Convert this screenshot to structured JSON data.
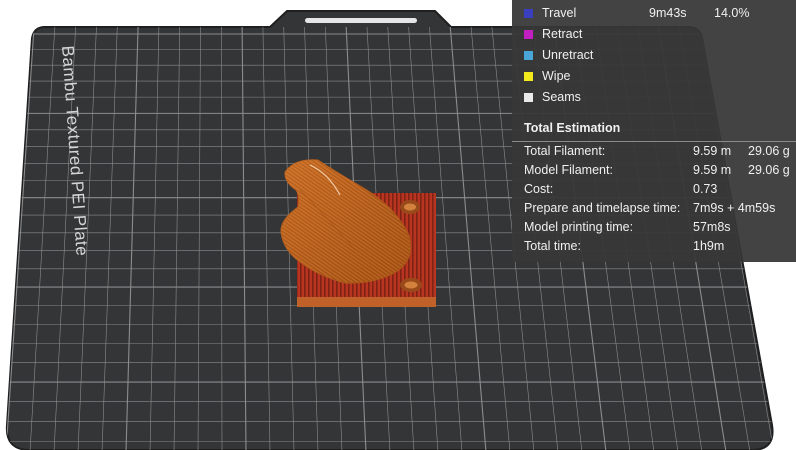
{
  "plate": {
    "label": "Bambu Textured PEI Plate"
  },
  "legend": {
    "items": [
      {
        "label": "Travel",
        "color": "#3a3fbf",
        "time": "9m43s",
        "percent": "14.0%"
      },
      {
        "label": "Retract",
        "color": "#c21fc2",
        "time": "",
        "percent": ""
      },
      {
        "label": "Unretract",
        "color": "#4aa6d6",
        "time": "",
        "percent": ""
      },
      {
        "label": "Wipe",
        "color": "#f2ea1a",
        "time": "",
        "percent": ""
      },
      {
        "label": "Seams",
        "color": "#eaeaea",
        "time": "",
        "percent": ""
      }
    ]
  },
  "estimation": {
    "title": "Total Estimation",
    "rows": [
      {
        "label": "Total Filament:",
        "value": "9.59 m",
        "value2": "29.06 g"
      },
      {
        "label": "Model Filament:",
        "value": "9.59 m",
        "value2": "29.06 g"
      },
      {
        "label": "Cost:",
        "value": "0.73",
        "value2": ""
      },
      {
        "label": "Prepare and timelapse time:",
        "value": "7m9s + 4m59s",
        "value2": ""
      },
      {
        "label": "Model printing time:",
        "value": "57m8s",
        "value2": ""
      },
      {
        "label": "Total time:",
        "value": "1h9m",
        "value2": ""
      }
    ]
  },
  "colors": {
    "plate": "#333436",
    "grid": "#8b8c8e",
    "model_orange": "#c9651c",
    "model_base_red": "#b83722"
  }
}
